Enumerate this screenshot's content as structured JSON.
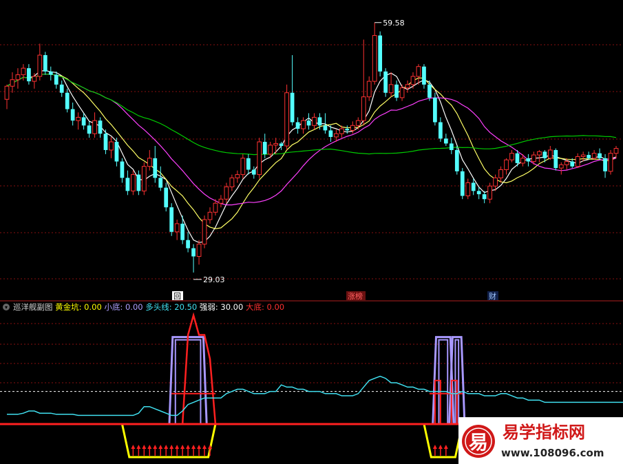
{
  "indicator_header": {
    "name": "巡洋舰副图",
    "fields": [
      {
        "label": "黄金坑",
        "value": "0.00",
        "color": "#ffff00"
      },
      {
        "label": "小底",
        "value": "0.00",
        "color": "#b0a0ff"
      },
      {
        "label": "多头线",
        "value": "20.50",
        "color": "#40e0f0"
      },
      {
        "label": "强弱",
        "value": "30.00",
        "color": "#ffffff"
      },
      {
        "label": "大底",
        "value": "0.00",
        "color": "#ff3030"
      }
    ]
  },
  "markers": [
    {
      "text": "回",
      "color": "#ffcc66"
    },
    {
      "text": "涨榜",
      "color": "#ff6060"
    },
    {
      "text": "财",
      "color": "#a0c8ff"
    }
  ],
  "price_labels": {
    "high": "59.58",
    "low": "29.03"
  },
  "watermark": {
    "title": "易学指标网",
    "url": "www.108096.com",
    "logo_char": "易"
  },
  "colors": {
    "up": "#ff3232",
    "down": "#54ffff",
    "ma5": "#ffffff",
    "ma10": "#ffff66",
    "ma20": "#ff40ff",
    "ma60": "#00cc00",
    "bg": "#000000"
  },
  "chart_data": [
    {
      "type": "candlestick",
      "ylim": [
        27,
        62
      ],
      "note_high": 59.58,
      "note_low": 29.03,
      "candles": [
        [
          50.2,
          52.0,
          49.0,
          51.8
        ],
        [
          51.8,
          53.5,
          51.0,
          52.6
        ],
        [
          52.6,
          54.0,
          51.5,
          53.2
        ],
        [
          53.2,
          54.5,
          52.5,
          54.0
        ],
        [
          54.0,
          54.5,
          52.0,
          52.4
        ],
        [
          52.4,
          53.4,
          51.5,
          53.0
        ],
        [
          53.0,
          57.0,
          52.5,
          55.6
        ],
        [
          55.6,
          56.0,
          53.2,
          53.6
        ],
        [
          53.6,
          54.2,
          52.5,
          53.2
        ],
        [
          53.2,
          53.6,
          51.5,
          52.0
        ],
        [
          52.0,
          52.5,
          50.5,
          51.0
        ],
        [
          51.0,
          51.5,
          48.6,
          49.0
        ],
        [
          49.0,
          49.8,
          47.0,
          47.6
        ],
        [
          47.6,
          48.6,
          46.5,
          48.0
        ],
        [
          48.0,
          48.5,
          46.5,
          47.0
        ],
        [
          47.0,
          47.5,
          45.5,
          46.0
        ],
        [
          46.0,
          48.6,
          45.5,
          47.6
        ],
        [
          47.6,
          48.0,
          45.5,
          46.0
        ],
        [
          46.0,
          46.5,
          43.5,
          44.0
        ],
        [
          44.0,
          45.6,
          43.0,
          45.0
        ],
        [
          45.0,
          45.5,
          42.0,
          42.6
        ],
        [
          42.6,
          43.0,
          40.0,
          40.6
        ],
        [
          40.6,
          41.5,
          38.5,
          39.0
        ],
        [
          39.0,
          41.5,
          38.5,
          41.0
        ],
        [
          41.0,
          41.5,
          38.5,
          39.0
        ],
        [
          39.0,
          42.5,
          38.5,
          42.0
        ],
        [
          42.0,
          44.0,
          41.5,
          43.0
        ],
        [
          43.0,
          44.5,
          40.0,
          40.6
        ],
        [
          40.6,
          42.0,
          39.0,
          39.4
        ],
        [
          39.4,
          40.0,
          36.5,
          37.0
        ],
        [
          37.0,
          37.5,
          33.5,
          34.0
        ],
        [
          34.0,
          35.5,
          33.0,
          35.0
        ],
        [
          35.0,
          36.0,
          32.5,
          33.0
        ],
        [
          33.0,
          34.0,
          31.5,
          32.0
        ],
        [
          32.0,
          32.5,
          29.03,
          31.0
        ],
        [
          31.0,
          33.0,
          30.0,
          32.5
        ],
        [
          32.5,
          36.0,
          32.0,
          35.5
        ],
        [
          35.5,
          37.0,
          35.0,
          36.4
        ],
        [
          36.4,
          38.0,
          36.0,
          37.5
        ],
        [
          37.5,
          38.5,
          37.0,
          38.0
        ],
        [
          38.0,
          40.0,
          37.5,
          39.5
        ],
        [
          39.5,
          41.0,
          39.0,
          40.6
        ],
        [
          40.6,
          41.5,
          40.0,
          41.0
        ],
        [
          41.0,
          43.5,
          40.5,
          43.0
        ],
        [
          43.0,
          43.5,
          41.0,
          41.6
        ],
        [
          41.6,
          42.0,
          40.5,
          41.0
        ],
        [
          41.0,
          45.5,
          40.5,
          45.0
        ],
        [
          45.0,
          46.0,
          43.0,
          43.5
        ],
        [
          43.5,
          45.0,
          43.0,
          44.6
        ],
        [
          44.6,
          45.5,
          43.5,
          44.8
        ],
        [
          44.8,
          45.0,
          44.0,
          44.5
        ],
        [
          44.5,
          52.0,
          44.0,
          51.0
        ],
        [
          51.0,
          55.6,
          47.0,
          47.4
        ],
        [
          47.4,
          48.0,
          46.0,
          46.6
        ],
        [
          46.6,
          48.0,
          46.0,
          47.6
        ],
        [
          47.6,
          48.5,
          46.5,
          47.0
        ],
        [
          47.0,
          48.5,
          46.5,
          48.0
        ],
        [
          48.0,
          48.5,
          46.5,
          47.0
        ],
        [
          47.0,
          48.5,
          46.0,
          46.4
        ],
        [
          46.4,
          47.0,
          45.0,
          45.6
        ],
        [
          45.6,
          46.5,
          45.0,
          46.0
        ],
        [
          46.0,
          47.0,
          45.5,
          46.6
        ],
        [
          46.6,
          47.0,
          46.0,
          46.4
        ],
        [
          46.4,
          47.5,
          46.0,
          47.0
        ],
        [
          47.0,
          48.0,
          46.5,
          47.6
        ],
        [
          47.6,
          57.5,
          47.0,
          50.5
        ],
        [
          50.5,
          53.0,
          50.0,
          52.4
        ],
        [
          52.4,
          59.58,
          52.0,
          58.0
        ],
        [
          58.0,
          58.5,
          53.0,
          53.6
        ],
        [
          53.6,
          54.0,
          50.5,
          51.0
        ],
        [
          51.0,
          53.5,
          50.5,
          52.0
        ],
        [
          52.0,
          52.5,
          50.0,
          50.4
        ],
        [
          50.4,
          52.0,
          50.0,
          51.6
        ],
        [
          51.6,
          52.5,
          51.0,
          52.0
        ],
        [
          52.0,
          53.5,
          51.5,
          53.0
        ],
        [
          53.0,
          54.5,
          52.0,
          54.2
        ],
        [
          54.2,
          54.5,
          51.5,
          52.0
        ],
        [
          52.0,
          52.5,
          50.0,
          50.4
        ],
        [
          50.4,
          51.0,
          47.0,
          47.4
        ],
        [
          47.4,
          48.0,
          45.0,
          45.4
        ],
        [
          45.4,
          46.0,
          44.5,
          44.8
        ],
        [
          44.8,
          45.5,
          43.5,
          44.0
        ],
        [
          44.0,
          44.5,
          41.0,
          41.4
        ],
        [
          41.4,
          41.8,
          38.0,
          38.4
        ],
        [
          38.4,
          40.5,
          38.0,
          40.0
        ],
        [
          40.0,
          40.5,
          38.5,
          39.0
        ],
        [
          39.0,
          39.5,
          38.0,
          38.6
        ],
        [
          38.6,
          39.0,
          37.5,
          38.0
        ],
        [
          38.0,
          40.0,
          37.5,
          39.6
        ],
        [
          39.6,
          41.0,
          39.0,
          40.6
        ],
        [
          40.6,
          42.0,
          40.0,
          41.6
        ],
        [
          41.6,
          43.0,
          41.0,
          42.8
        ],
        [
          42.8,
          44.0,
          42.5,
          43.6
        ],
        [
          43.6,
          44.0,
          42.0,
          42.4
        ],
        [
          42.4,
          43.5,
          42.0,
          43.0
        ],
        [
          43.0,
          43.5,
          42.0,
          42.6
        ],
        [
          42.6,
          43.8,
          42.2,
          43.4
        ],
        [
          43.4,
          44.0,
          42.5,
          43.8
        ],
        [
          43.8,
          44.0,
          42.5,
          43.0
        ],
        [
          43.0,
          44.5,
          42.8,
          44.0
        ],
        [
          44.0,
          44.2,
          41.5,
          41.8
        ],
        [
          41.8,
          42.5,
          41.0,
          42.2
        ],
        [
          42.2,
          43.0,
          41.6,
          42.6
        ],
        [
          42.6,
          43.0,
          41.8,
          42.0
        ],
        [
          42.0,
          43.6,
          41.8,
          43.2
        ],
        [
          43.2,
          43.8,
          42.6,
          43.4
        ],
        [
          43.4,
          43.8,
          42.8,
          43.0
        ],
        [
          43.0,
          44.0,
          42.8,
          43.6
        ],
        [
          43.6,
          44.2,
          42.8,
          43.0
        ],
        [
          43.0,
          43.5,
          40.6,
          41.4
        ],
        [
          41.4,
          44.0,
          41.0,
          43.6
        ],
        [
          43.6,
          44.5,
          43.0,
          44.2
        ]
      ],
      "ma_lines": [
        {
          "name": "MA5",
          "window": 5
        },
        {
          "name": "MA10",
          "window": 10
        },
        {
          "name": "MA20",
          "window": 20
        },
        {
          "name": "MA60",
          "window": 60
        }
      ]
    },
    {
      "type": "line",
      "ylim": [
        0,
        100
      ],
      "reference_line": 30,
      "多头线": [
        9,
        9,
        9,
        10,
        12,
        12,
        10,
        10,
        10,
        9,
        9,
        9,
        9,
        8,
        8,
        8,
        8,
        8,
        8,
        8,
        8,
        8,
        8,
        8,
        10,
        16,
        16,
        14,
        12,
        10,
        8,
        8,
        12,
        18,
        20,
        22,
        24,
        24,
        24,
        24,
        28,
        30,
        32,
        32,
        30,
        28,
        28,
        28,
        30,
        30,
        36,
        34,
        34,
        32,
        32,
        30,
        30,
        30,
        28,
        28,
        28,
        26,
        26,
        26,
        28,
        34,
        40,
        42,
        44,
        42,
        38,
        38,
        36,
        34,
        34,
        32,
        32,
        30,
        30,
        30,
        30,
        28,
        28,
        30,
        28,
        28,
        28,
        26,
        26,
        26,
        28,
        28,
        26,
        24,
        24,
        22,
        22,
        22,
        20,
        20,
        20,
        20,
        20,
        20,
        20,
        20,
        20,
        20,
        20,
        20,
        20,
        20,
        20,
        20,
        20,
        20,
        20,
        20,
        21,
        20.5
      ],
      "大底": {
        "baseline": 3,
        "spikes": [
          [
            33,
            82
          ],
          [
            34,
            100
          ],
          [
            35,
            82
          ],
          [
            36,
            82
          ],
          [
            37,
            60
          ]
        ]
      },
      "小底": {
        "plateaus": [
          [
            31,
            35,
            80
          ],
          [
            79,
            80,
            80
          ],
          [
            82,
            82,
            80
          ]
        ]
      },
      "黄金坑": {
        "dips": [
          [
            21,
            38
          ],
          [
            76,
            83
          ]
        ],
        "depth": -30,
        "arrows": [
          23,
          37
        ]
      }
    }
  ]
}
